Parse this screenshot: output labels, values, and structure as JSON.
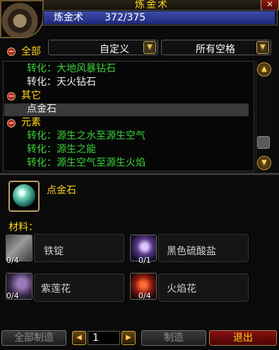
{
  "window": {
    "title": "炼金术"
  },
  "skill": {
    "name": "炼金术",
    "value": "372/375"
  },
  "filter": {
    "all_label": "全部",
    "subclass_selected": "自定义",
    "slot_selected": "所有空格"
  },
  "recipes": [
    {
      "kind": "recipe",
      "label": "转化：大地风暴钻石",
      "color": "green"
    },
    {
      "kind": "recipe",
      "label": "转化：天火钻石",
      "color": "white"
    },
    {
      "kind": "header",
      "label": "其它"
    },
    {
      "kind": "recipe",
      "label": "点金石",
      "color": "white",
      "selected": true
    },
    {
      "kind": "header",
      "label": "元素"
    },
    {
      "kind": "recipe",
      "label": "转化：源生之水至源生空气",
      "color": "green"
    },
    {
      "kind": "recipe",
      "label": "转化：源生之能",
      "color": "green"
    },
    {
      "kind": "recipe",
      "label": "转化：源生空气至源生火焰",
      "color": "green"
    }
  ],
  "selected_item": {
    "name": "点金石",
    "icon": "philosophers-stone-icon"
  },
  "materials": {
    "label": "材料：",
    "items": [
      {
        "name": "铁锭",
        "count": "0/4",
        "icon": "iron-bar-icon"
      },
      {
        "name": "黑色硫酸盐",
        "count": "0/1",
        "icon": "black-vitriol-icon"
      },
      {
        "name": "紫莲花",
        "count": "0/4",
        "icon": "purple-lotus-icon"
      },
      {
        "name": "火焰花",
        "count": "0/4",
        "icon": "firebloom-icon"
      }
    ]
  },
  "bottom": {
    "create_all": "全部制造",
    "quantity": "1",
    "create": "制造",
    "exit": "退出"
  },
  "colors": {
    "gold": "#ffd21f",
    "green": "#3ad23a",
    "skill_bar": "#2c3a96",
    "exit_red": "#7a0a0a"
  }
}
